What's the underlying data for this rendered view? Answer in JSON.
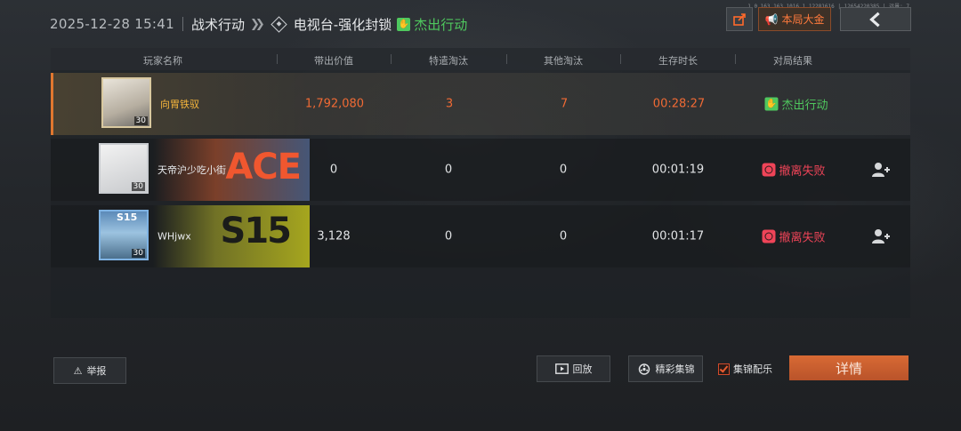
{
  "header": {
    "datetime": "2025-12-28 15:41",
    "mode": "战术行动",
    "map": "电视台-强化封锁",
    "result": "杰出行动"
  },
  "top_right": {
    "tiny_ids": "1.0.163.163.1016.1.12281616 | 12654220385 | 远景: 7",
    "treasure_label": "本局大金"
  },
  "table": {
    "headers": [
      "玩家名称",
      "带出价值",
      "特遣淘汰",
      "其他淘汰",
      "生存时长",
      "对局结果"
    ],
    "rows": [
      {
        "name": "向胃铁驭",
        "level": "30",
        "value": "1,792,080",
        "special_kills": "3",
        "other_kills": "7",
        "survival": "00:28:27",
        "result": "杰出行动"
      },
      {
        "name": "天帝沪少吃小街",
        "level": "30",
        "value": "0",
        "special_kills": "0",
        "other_kills": "0",
        "survival": "00:01:19",
        "result": "撤离失败",
        "banner": "ACE"
      },
      {
        "name": "WHjwx",
        "level": "30",
        "value": "3,128",
        "special_kills": "0",
        "other_kills": "0",
        "survival": "00:01:17",
        "result": "撤离失败",
        "banner": "S15",
        "avatar_tag": "S15"
      }
    ]
  },
  "bottom": {
    "report_label": "举报",
    "replay_label": "回放",
    "highlight_label": "精彩集锦",
    "music_label": "集锦配乐",
    "music_checked": true,
    "detail_label": "详情"
  },
  "colors": {
    "accent_orange": "#e0772f",
    "success_green": "#4fc85e",
    "fail_red": "#ef4458"
  }
}
